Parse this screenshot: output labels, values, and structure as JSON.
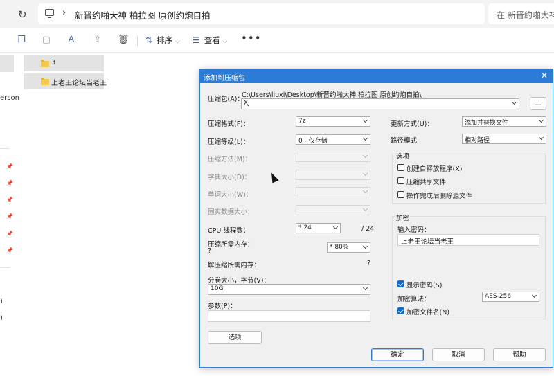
{
  "address_bar": {
    "path": "新晋约啪大神 柏拉图 原创约炮自拍",
    "separator": "›",
    "search_placeholder": "在 新晋约啪大神"
  },
  "toolbar": {
    "sort_label": "排序",
    "view_label": "查看",
    "more_label": "•••"
  },
  "navigation": {
    "partial_text": "erson",
    "paren_1": ")",
    "paren_2": ")"
  },
  "files": [
    {
      "name": "3"
    },
    {
      "name": "上老王论坛当老王"
    }
  ],
  "dialog": {
    "title": "添加到压缩包",
    "archive_label": "压缩包(A)：",
    "archive_path": "C:\\Users\\liuxi\\Desktop\\新晋约啪大神 柏拉图 原创约炮自拍\\",
    "archive_name": "XJ",
    "browse_label": "...",
    "format_label": "压缩格式(F)：",
    "format_value": "7z",
    "level_label": "压缩等级(L)：",
    "level_value": "0 - 仅存储",
    "method_label": "压缩方法(M)：",
    "dict_label": "字典大小(D)：",
    "word_label": "单词大小(W)：",
    "solid_label": "固实数据大小：",
    "cpu_label": "CPU 线程数：",
    "cpu_value": "* 24",
    "cpu_total": "/ 24",
    "mem_comp_label": "压缩所需内存：",
    "mem_comp_q": "?",
    "mem_comp_value": "* 80%",
    "mem_decomp_label": "解压缩所需内存：",
    "mem_decomp_q": "?",
    "split_label": "分卷大小，字节(V)：",
    "split_value": "10G",
    "params_label": "参数(P)：",
    "options_button": "选项",
    "update_label": "更新方式(U)：",
    "update_value": "添加并替换文件",
    "path_mode_label": "路径模式",
    "path_mode_value": "相对路径",
    "options_group": "选项",
    "opt_sfx": "创建自释放程序(X)",
    "opt_shared": "压缩共享文件",
    "opt_delete": "操作完成后删除源文件",
    "encrypt_group": "加密",
    "password_label": "输入密码：",
    "password_value": "上老王论坛当老王",
    "show_password": "显示密码(S)",
    "enc_method_label": "加密算法：",
    "enc_method_value": "AES-256",
    "encrypt_names": "加密文件名(N)",
    "ok": "确定",
    "cancel": "取消",
    "help": "帮助"
  }
}
